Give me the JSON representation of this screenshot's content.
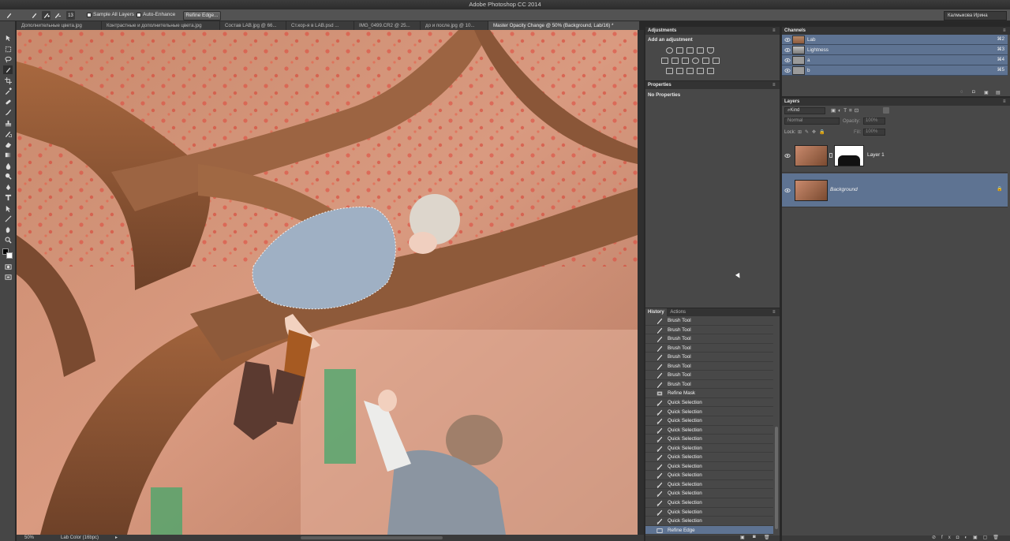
{
  "app": {
    "title": "Adobe Photoshop CC 2014"
  },
  "options_bar": {
    "brush_size": "13",
    "sample_all_layers": "Sample All Layers",
    "auto_enhance": "Auto-Enhance",
    "refine_edge_button": "Refine Edge...",
    "user_name": "Калмыкова Ирина"
  },
  "tabs": [
    {
      "label": "Дополнительные цвета.jpg"
    },
    {
      "label": "Контрастные и дополнительные цвета.jpg"
    },
    {
      "label": "Состав LAB.jpg @ 66..."
    },
    {
      "label": "Ст.кор-я в LAB.psd ..."
    },
    {
      "label": "IMG_0499.CR2 @ 25..."
    },
    {
      "label": "до и после.jpg @ 10..."
    },
    {
      "label": "Master Opacity Change @ 50% (Background, Lab/16) *"
    }
  ],
  "status_bar": {
    "zoom": "50%",
    "doc_info": "Lab Color (16bpc)"
  },
  "adjustments": {
    "title": "Adjustments",
    "subtitle": "Add an adjustment"
  },
  "properties": {
    "title": "Properties",
    "content": "No Properties"
  },
  "channels": {
    "title": "Channels",
    "rows": [
      {
        "name": "Lab",
        "shortcut": "⌘2"
      },
      {
        "name": "Lightness",
        "shortcut": "⌘3"
      },
      {
        "name": "a",
        "shortcut": "⌘4"
      },
      {
        "name": "b",
        "shortcut": "⌘5"
      }
    ]
  },
  "layers": {
    "title": "Layers",
    "filter_kind": "Kind",
    "blend_mode": "Normal",
    "opacity_label": "Opacity:",
    "opacity_value": "100%",
    "lock_label": "Lock:",
    "fill_label": "Fill:",
    "fill_value": "100%",
    "rows": [
      {
        "name": "Layer 1",
        "active": false
      },
      {
        "name": "Background",
        "active": true
      }
    ]
  },
  "history": {
    "tab_history": "History",
    "tab_actions": "Actions",
    "items": [
      {
        "name": "Brush Tool",
        "icon": "brush-icon"
      },
      {
        "name": "Brush Tool",
        "icon": "brush-icon"
      },
      {
        "name": "Brush Tool",
        "icon": "brush-icon"
      },
      {
        "name": "Brush Tool",
        "icon": "brush-icon"
      },
      {
        "name": "Brush Tool",
        "icon": "brush-icon"
      },
      {
        "name": "Brush Tool",
        "icon": "brush-icon"
      },
      {
        "name": "Brush Tool",
        "icon": "brush-icon"
      },
      {
        "name": "Brush Tool",
        "icon": "brush-icon"
      },
      {
        "name": "Refine Mask",
        "icon": "mask-icon"
      },
      {
        "name": "Quick Selection",
        "icon": "quick-selection-icon"
      },
      {
        "name": "Quick Selection",
        "icon": "quick-selection-icon"
      },
      {
        "name": "Quick Selection",
        "icon": "quick-selection-icon"
      },
      {
        "name": "Quick Selection",
        "icon": "quick-selection-icon"
      },
      {
        "name": "Quick Selection",
        "icon": "quick-selection-icon"
      },
      {
        "name": "Quick Selection",
        "icon": "quick-selection-icon"
      },
      {
        "name": "Quick Selection",
        "icon": "quick-selection-icon"
      },
      {
        "name": "Quick Selection",
        "icon": "quick-selection-icon"
      },
      {
        "name": "Quick Selection",
        "icon": "quick-selection-icon"
      },
      {
        "name": "Quick Selection",
        "icon": "quick-selection-icon"
      },
      {
        "name": "Quick Selection",
        "icon": "quick-selection-icon"
      },
      {
        "name": "Quick Selection",
        "icon": "quick-selection-icon"
      },
      {
        "name": "Quick Selection",
        "icon": "quick-selection-icon"
      },
      {
        "name": "Quick Selection",
        "icon": "quick-selection-icon"
      },
      {
        "name": "Refine Edge",
        "icon": "refine-edge-icon"
      }
    ]
  },
  "colors": {
    "accent_selected": "#5e7392",
    "panel_bg": "#484848"
  }
}
